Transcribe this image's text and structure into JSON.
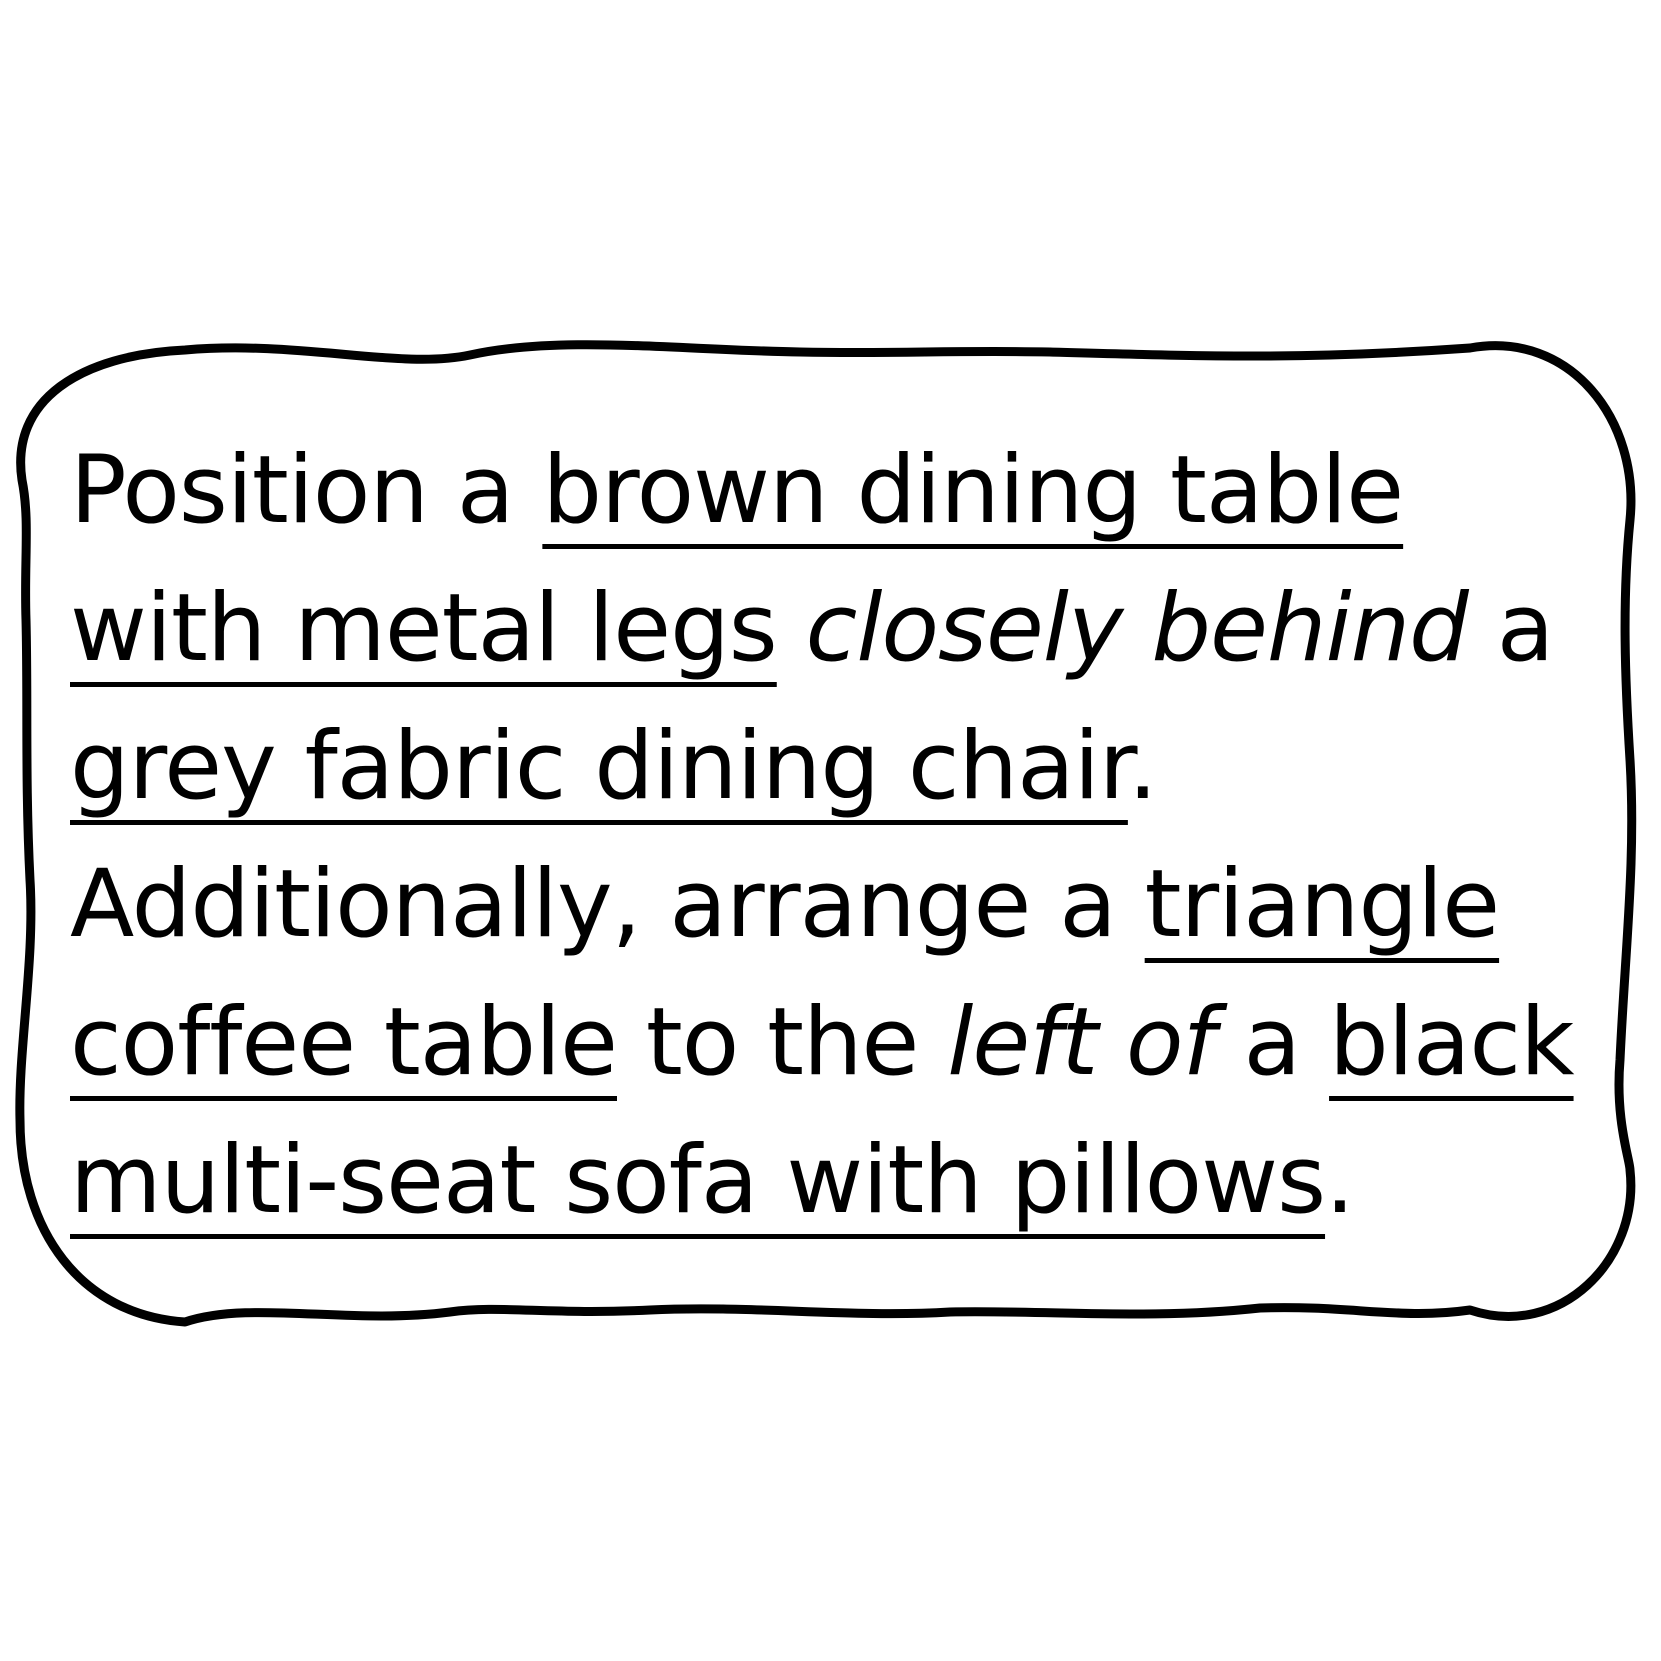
{
  "colors": {
    "background": "#ffffff",
    "ink": "#000000"
  },
  "prompt": {
    "line1": {
      "pre": "Position a ",
      "obj": "brown dining table"
    },
    "line2": {
      "obj": "with metal legs",
      "space1": " ",
      "rel": "closely behind",
      "post": " a"
    },
    "line3": {
      "obj": "grey fabric dining chair",
      "post": "."
    },
    "line4": {
      "pre": "Additionally, arrange a ",
      "obj": "triangle"
    },
    "line5": {
      "obj": "coffee table",
      "mid": " to the ",
      "rel": "left of",
      "post": " a ",
      "obj2": "black"
    },
    "line6": {
      "obj": "multi-seat sofa with pillows",
      "post": "."
    }
  }
}
